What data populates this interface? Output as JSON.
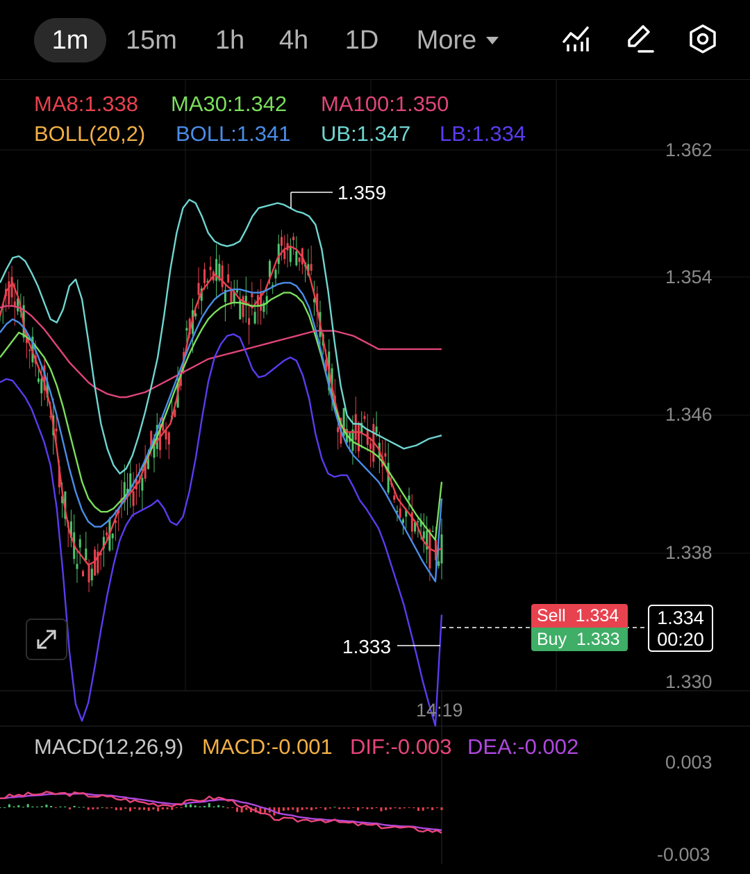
{
  "toolbar": {
    "timeframes": [
      "1m",
      "15m",
      "1h",
      "4h",
      "1D"
    ],
    "active": "1m",
    "more_label": "More",
    "icons": [
      "indicator-icon",
      "draw-icon",
      "settings-icon"
    ]
  },
  "legend": {
    "ma8": "MA8:1.338",
    "ma30": "MA30:1.342",
    "ma100": "MA100:1.350",
    "boll": "BOLL(20,2)",
    "boll_mid": "BOLL:1.341",
    "ub": "UB:1.347",
    "lb": "LB:1.334"
  },
  "colors": {
    "ma8": "#e8424f",
    "ma30": "#7bde5c",
    "ma100": "#e0457a",
    "boll": "#f2b046",
    "boll_mid": "#4a8de8",
    "ub": "#6fd6d1",
    "lb": "#5a3cf0",
    "up": "#4fc46e",
    "down": "#e8424f",
    "macd_label": "#f2b046",
    "dif": "#e8457a",
    "dea": "#b048e0"
  },
  "price_axis": [
    "1.362",
    "1.354",
    "1.346",
    "1.338",
    "1.330"
  ],
  "time_axis": [
    "14:19"
  ],
  "high_label": "1.359",
  "low_label": "1.333",
  "sell": {
    "label": "Sell",
    "price": "1.334"
  },
  "buy": {
    "label": "Buy",
    "price": "1.333"
  },
  "current": {
    "price": "1.334",
    "countdown": "00:20"
  },
  "macd_legend": {
    "title": "MACD(12,26,9)",
    "macd": "MACD:-0.001",
    "dif": "DIF:-0.003",
    "dea": "DEA:-0.002"
  },
  "macd_axis": [
    "0.003",
    "-0.003"
  ],
  "chart_data": {
    "type": "line",
    "ylim": [
      1.33,
      1.362
    ],
    "x": [
      0,
      1,
      2,
      3,
      4,
      5,
      6,
      7,
      8,
      9,
      10,
      11,
      12,
      13,
      14,
      15,
      16,
      17,
      18,
      19,
      20,
      21,
      22,
      23,
      24,
      25,
      26,
      27,
      28,
      29,
      30,
      31,
      32,
      33,
      34,
      35,
      36,
      37,
      38,
      39,
      40,
      41,
      42,
      43,
      44,
      45,
      46,
      47,
      48,
      49,
      50,
      51,
      52,
      53,
      54,
      55,
      56,
      57,
      58,
      59,
      60,
      61,
      62,
      63,
      64,
      65,
      66,
      67,
      68,
      69,
      70
    ],
    "series": [
      {
        "name": "MA8",
        "values": [
          1.352,
          1.3535,
          1.354,
          1.353,
          1.351,
          1.35,
          1.349,
          1.348,
          1.3465,
          1.344,
          1.341,
          1.339,
          1.338,
          1.3375,
          1.337,
          1.3372,
          1.3378,
          1.3385,
          1.3395,
          1.3405,
          1.341,
          1.3415,
          1.342,
          1.343,
          1.344,
          1.3445,
          1.345,
          1.3455,
          1.347,
          1.349,
          1.351,
          1.3525,
          1.3535,
          1.354,
          1.3545,
          1.3542,
          1.3538,
          1.3535,
          1.353,
          1.3528,
          1.3525,
          1.353,
          1.3535,
          1.3545,
          1.3555,
          1.356,
          1.3562,
          1.356,
          1.3555,
          1.3545,
          1.353,
          1.351,
          1.349,
          1.347,
          1.3455,
          1.345,
          1.345,
          1.345,
          1.3448,
          1.3445,
          1.344,
          1.343,
          1.342,
          1.341,
          1.3405,
          1.34,
          1.3395,
          1.3385,
          1.338,
          1.3378,
          1.338
        ]
      },
      {
        "name": "MA30",
        "values": [
          1.3495,
          1.35,
          1.3505,
          1.351,
          1.3508,
          1.3505,
          1.35,
          1.3495,
          1.3488,
          1.3478,
          1.3465,
          1.345,
          1.3435,
          1.342,
          1.341,
          1.3405,
          1.3402,
          1.3402,
          1.3404,
          1.3408,
          1.3412,
          1.3418,
          1.3425,
          1.3432,
          1.344,
          1.3448,
          1.3458,
          1.3468,
          1.3478,
          1.3488,
          1.3497,
          1.3505,
          1.3512,
          1.3518,
          1.3522,
          1.3525,
          1.3527,
          1.3528,
          1.3528,
          1.3527,
          1.3526,
          1.3526,
          1.3527,
          1.353,
          1.3532,
          1.3534,
          1.3534,
          1.3532,
          1.3528,
          1.352,
          1.3508,
          1.3495,
          1.348,
          1.3466,
          1.3455,
          1.3448,
          1.3444,
          1.3442,
          1.344,
          1.3438,
          1.3435,
          1.343,
          1.3424,
          1.3418,
          1.3412,
          1.3406,
          1.34,
          1.3395,
          1.339,
          1.3385,
          1.342
        ]
      },
      {
        "name": "MA100",
        "values": [
          1.3525,
          1.3526,
          1.3526,
          1.3525,
          1.3523,
          1.352,
          1.3516,
          1.3512,
          1.3507,
          1.3502,
          1.3497,
          1.3492,
          1.3488,
          1.3484,
          1.348,
          1.3477,
          1.3475,
          1.3473,
          1.3472,
          1.3471,
          1.3471,
          1.3472,
          1.3473,
          1.3474,
          1.3476,
          1.3478,
          1.348,
          1.3482,
          1.3484,
          1.3486,
          1.3488,
          1.349,
          1.3492,
          1.3494,
          1.3495,
          1.3496,
          1.3497,
          1.3498,
          1.3499,
          1.35,
          1.3501,
          1.3502,
          1.3503,
          1.3504,
          1.3505,
          1.3506,
          1.3507,
          1.3508,
          1.3509,
          1.351,
          1.3511,
          1.3511,
          1.3511,
          1.3511,
          1.351,
          1.3509,
          1.3508,
          1.3506,
          1.3504,
          1.3502,
          1.35,
          1.35,
          1.35,
          1.35,
          1.35,
          1.35,
          1.35,
          1.35,
          1.35,
          1.35,
          1.35
        ]
      },
      {
        "name": "BOLL",
        "values": [
          1.351,
          1.3515,
          1.3518,
          1.3516,
          1.3512,
          1.3505,
          1.3496,
          1.3486,
          1.3474,
          1.346,
          1.3444,
          1.3428,
          1.3414,
          1.3403,
          1.3396,
          1.3393,
          1.3393,
          1.3396,
          1.34,
          1.3405,
          1.3411,
          1.3418,
          1.3425,
          1.3433,
          1.3442,
          1.3452,
          1.3462,
          1.3472,
          1.3482,
          1.3492,
          1.3502,
          1.3511,
          1.3519,
          1.3525,
          1.353,
          1.3533,
          1.3535,
          1.3536,
          1.3536,
          1.3535,
          1.3534,
          1.3534,
          1.3535,
          1.3537,
          1.3539,
          1.354,
          1.354,
          1.3538,
          1.3533,
          1.3525,
          1.3512,
          1.3497,
          1.348,
          1.3464,
          1.3451,
          1.3442,
          1.3436,
          1.3432,
          1.3428,
          1.3424,
          1.342,
          1.3414,
          1.3407,
          1.34,
          1.3393,
          1.3386,
          1.3379,
          1.3372,
          1.3366,
          1.336,
          1.341
        ]
      },
      {
        "name": "UB",
        "values": [
          1.354,
          1.3548,
          1.3555,
          1.3556,
          1.3553,
          1.3546,
          1.3538,
          1.3528,
          1.3518,
          1.3516,
          1.3524,
          1.3538,
          1.3542,
          1.353,
          1.3505,
          1.3478,
          1.3455,
          1.344,
          1.343,
          1.3425,
          1.3428,
          1.3436,
          1.3448,
          1.3462,
          1.3478,
          1.3495,
          1.352,
          1.3548,
          1.357,
          1.3585,
          1.359,
          1.3588,
          1.358,
          1.357,
          1.3565,
          1.3563,
          1.3562,
          1.3563,
          1.3565,
          1.3572,
          1.358,
          1.3585,
          1.3586,
          1.3587,
          1.3588,
          1.3587,
          1.3585,
          1.3583,
          1.3582,
          1.358,
          1.3575,
          1.356,
          1.3535,
          1.3505,
          1.3478,
          1.346,
          1.3455,
          1.3455,
          1.3452,
          1.345,
          1.3448,
          1.3446,
          1.3444,
          1.3442,
          1.344,
          1.3441,
          1.3442,
          1.3444,
          1.3446,
          1.3447,
          1.3448
        ]
      },
      {
        "name": "LB",
        "values": [
          1.348,
          1.3482,
          1.3481,
          1.3476,
          1.3471,
          1.3464,
          1.3454,
          1.3444,
          1.343,
          1.3404,
          1.3364,
          1.3318,
          1.3286,
          1.3276,
          1.3287,
          1.3308,
          1.3331,
          1.3352,
          1.337,
          1.3385,
          1.3394,
          1.34,
          1.3402,
          1.3404,
          1.3406,
          1.3409,
          1.3404,
          1.3396,
          1.3394,
          1.3399,
          1.3414,
          1.3434,
          1.3458,
          1.348,
          1.3495,
          1.3503,
          1.3508,
          1.3509,
          1.3507,
          1.3498,
          1.3488,
          1.3483,
          1.3484,
          1.3487,
          1.349,
          1.3493,
          1.3495,
          1.3493,
          1.3484,
          1.347,
          1.3449,
          1.3434,
          1.3425,
          1.3423,
          1.3424,
          1.3424,
          1.3417,
          1.3409,
          1.3404,
          1.3398,
          1.3392,
          1.3382,
          1.337,
          1.3358,
          1.3346,
          1.3331,
          1.3316,
          1.33,
          1.3286,
          1.3273,
          1.334
        ]
      }
    ]
  }
}
